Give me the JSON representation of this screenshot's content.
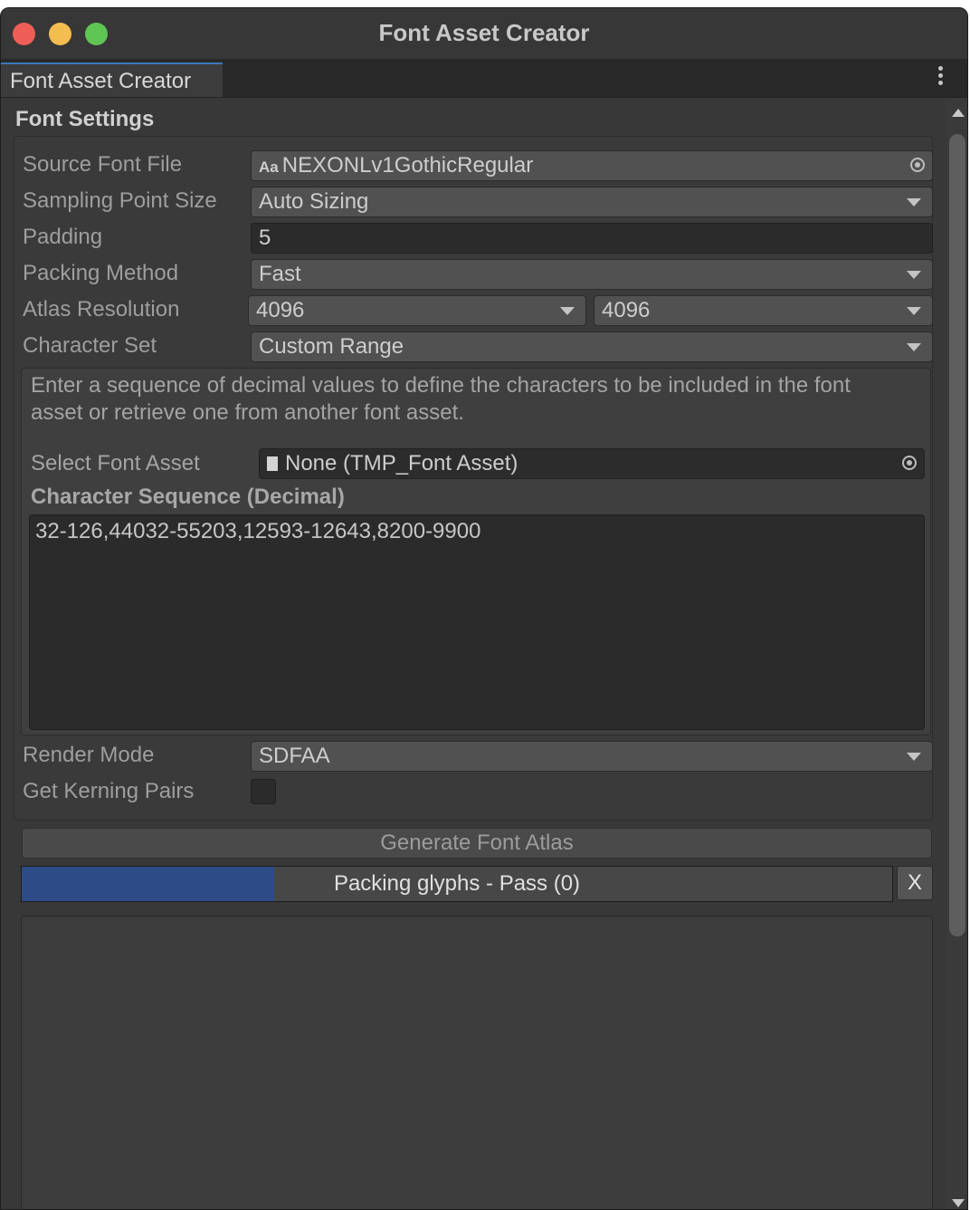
{
  "window": {
    "title": "Font Asset Creator",
    "traffic_lights": {
      "close_color": "#ee5e57",
      "minimize_color": "#f4bd4f",
      "maximize_color": "#5fc553"
    }
  },
  "tab": {
    "label": "Font Asset Creator",
    "menu_icon": "kebab-menu-icon"
  },
  "font_settings": {
    "section_title": "Font Settings",
    "source_font_file": {
      "label": "Source Font File",
      "icon": "Aa",
      "value": "NEXONLv1GothicRegular"
    },
    "sampling_point_size": {
      "label": "Sampling Point Size",
      "value": "Auto Sizing"
    },
    "padding": {
      "label": "Padding",
      "value": "5"
    },
    "packing_method": {
      "label": "Packing Method",
      "value": "Fast"
    },
    "atlas_resolution": {
      "label": "Atlas Resolution",
      "width": "4096",
      "height": "4096"
    },
    "character_set": {
      "label": "Character Set",
      "value": "Custom Range"
    },
    "help_text": "Enter a sequence of decimal values to define the characters to be included in the font asset or retrieve one from another font asset.",
    "select_font_asset": {
      "label": "Select Font Asset",
      "value": "None (TMP_Font Asset)"
    },
    "character_sequence": {
      "label": "Character Sequence (Decimal)",
      "value": "32-126,44032-55203,12593-12643,8200-9900"
    },
    "render_mode": {
      "label": "Render Mode",
      "value": "SDFAA"
    },
    "get_kerning_pairs": {
      "label": "Get Kerning Pairs",
      "checked": false
    }
  },
  "actions": {
    "generate_label": "Generate Font Atlas",
    "progress_label": "Packing glyphs - Pass (0)",
    "progress_fraction": 0.29,
    "progress_color": "#2d4b87",
    "cancel_label": "X"
  }
}
